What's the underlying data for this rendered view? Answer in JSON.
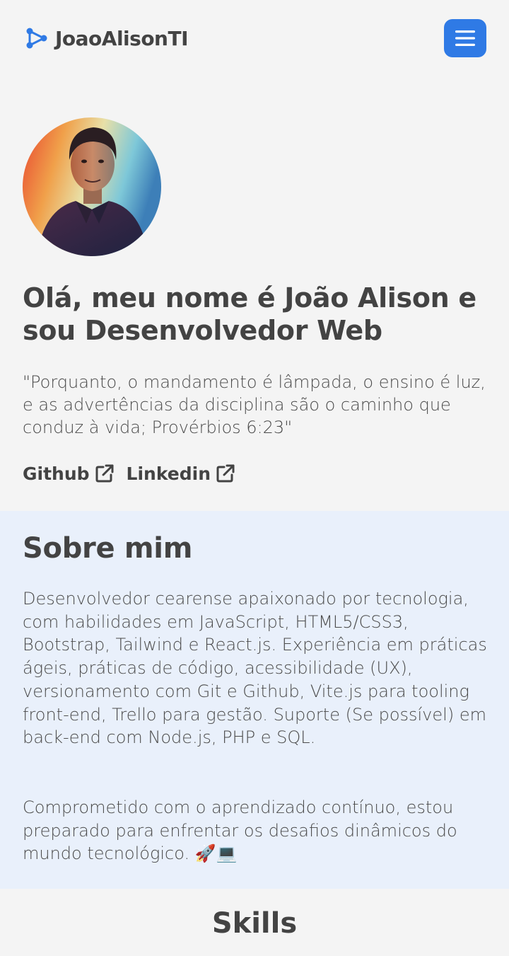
{
  "nav": {
    "brand": "JoaoAlisonTI",
    "brand_color": "#2f7ae5",
    "menu_icon": "hamburger-menu-icon",
    "menu_bg": "#2f7ae5"
  },
  "hero": {
    "title": "Olá, meu nome é João Alison e sou Desenvolvedor Web",
    "quote": "\"Porquanto, o mandamento é lâmpada, o ensino é luz, e as advertências da disciplina são o caminho que conduz à vida; Provérbios 6:23\"",
    "links": [
      {
        "label": "Github",
        "icon": "external-link-icon"
      },
      {
        "label": "Linkedin",
        "icon": "external-link-icon"
      }
    ]
  },
  "about": {
    "title": "Sobre mim",
    "paragraph1": "Desenvolvedor cearense apaixonado por tecnologia, com habilidades em JavaScript, HTML5/CSS3, Bootstrap, Tailwind e React.js. Experiência em práticas ágeis, práticas de código, acessibilidade (UX), versionamento com Git e Github, Vite.js para tooling front-end, Trello para gestão. Suporte (Se possível) em back-end com Node.js, PHP e SQL.",
    "paragraph2": "Comprometido com o aprendizado contínuo, estou preparado para enfrentar os desafios dinâmicos do mundo tecnológico. 🚀💻",
    "bg": "#e9f0fb"
  },
  "skills": {
    "title": "Skills"
  }
}
